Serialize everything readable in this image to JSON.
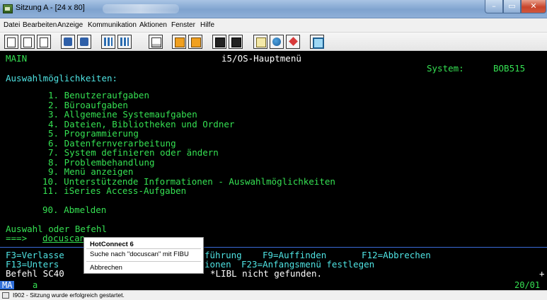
{
  "window": {
    "title": "Sitzung A - [24 x 80]",
    "controls": {
      "minimize": "–",
      "maximize": "▭",
      "close": "✕"
    }
  },
  "menubar": {
    "items": [
      "Datei",
      "Bearbeiten",
      "Anzeige",
      "Kommunikation",
      "Aktionen",
      "Fenster",
      "Hilfe"
    ]
  },
  "toolbar": {
    "icons": [
      "print-icon",
      "copy-icon",
      "paste-icon",
      "send-icon",
      "receive-icon",
      "display-icon",
      "keyboard-icon",
      "notes-icon",
      "macro-record-icon",
      "macro-play-icon",
      "stop-icon",
      "run-icon",
      "clipboard-icon",
      "globe-icon",
      "help-diamond-icon",
      "screen-icon"
    ]
  },
  "terminal": {
    "menu_id": "MAIN",
    "screen_title": "i5/OS-Hauptmenü",
    "system_label": "System:",
    "system_value": "BOB515",
    "heading": "Auswahlmöglichkeiten:",
    "options": [
      "1. Benutzeraufgaben",
      "2. Büroaufgaben",
      "3. Allgemeine Systemaufgaben",
      "4. Dateien, Bibliotheken und Ordner",
      "5. Programmierung",
      "6. Datenfernverarbeitung",
      "7. System definieren oder ändern",
      "8. Problembehandlung",
      "9. Menü anzeigen",
      "10. Unterstützende Informationen - Auswahlmöglichkeiten",
      "11. iSeries Access-Aufgaben"
    ],
    "option_logoff": "90. Abmelden",
    "command_label": "Auswahl oder Befehl",
    "prompt": "===>",
    "command_value": "docuscan",
    "fkeys_line1": {
      "f3": "F3=Verlasse",
      "f4_tail": "führung",
      "f9": "F9=Auffinden",
      "f12": "F12=Abbrechen"
    },
    "fkeys_line2": {
      "f13": "F13=Unters",
      "f16_tail": "ionen",
      "f23": "F23=Anfangsmenü festlegen"
    },
    "message": {
      "prefix": "Befehl SC40",
      "suffix": "*LIBL nicht gefunden.",
      "plus": "+"
    },
    "status": {
      "mode": "MA",
      "input": "a",
      "position": "20/01"
    }
  },
  "popup": {
    "title": "HotConnect 6",
    "search_item": "Suche nach \"docuscan\" mit FIBU",
    "cancel_item": "Abbrechen"
  },
  "statusbar": {
    "message": "I902 - Sitzung wurde erfolgreich gestartet."
  }
}
